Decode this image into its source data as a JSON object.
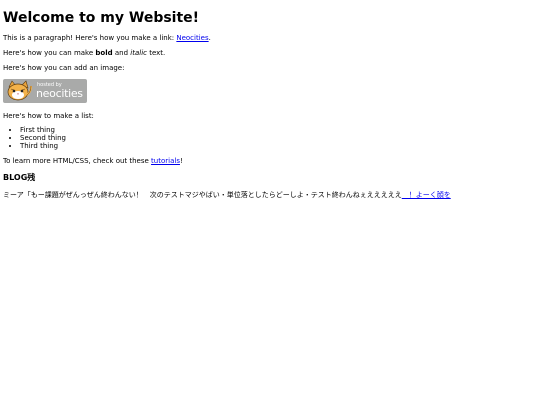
{
  "page": {
    "title": "Welcome to my Website!",
    "para1_prefix": "This is a paragraph! Here's how you make a link: ",
    "para1_link": "Neocities",
    "para1_suffix": ".",
    "para2_prefix": "Here's how you can make ",
    "para2_bold": "bold",
    "para2_middle": " and ",
    "para2_italic": "italic",
    "para2_suffix": " text.",
    "para3": "Here's how you can add an image:",
    "badge": {
      "hosted_text": "hosted by",
      "brand_text": "neocities",
      "icon": "neocities-cat-icon",
      "bg_color": "#a9aaa9"
    },
    "para4": "Here's how to make a list:",
    "list_items": [
      "First thing",
      "Second thing",
      "Third thing"
    ],
    "para5_prefix": "To learn more HTML/CSS, check out these ",
    "para5_link": "tutorials",
    "para5_suffix": "!",
    "blog_heading": "BLOG残",
    "blog_text": "ミーア「もー課題がぜんっぜん終わんない！　次のテストマジやばい・単位落としたらどーしよ・テスト終わんねぇえええええ",
    "blog_link": "　！よーく顔を"
  }
}
